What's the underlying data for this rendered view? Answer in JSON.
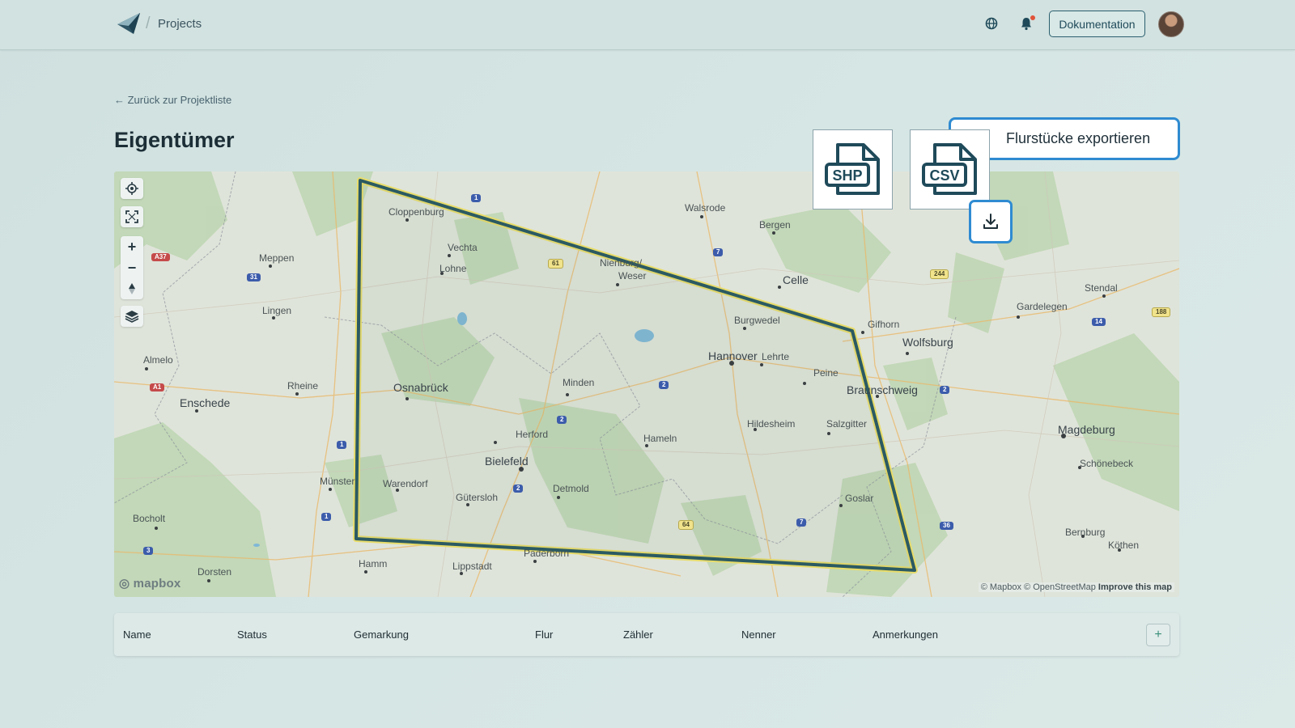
{
  "header": {
    "breadcrumb": "Projects",
    "doc_button": "Dokumentation",
    "icons": [
      "logo-icon",
      "globe-icon",
      "bell-icon",
      "avatar"
    ]
  },
  "page": {
    "back_link": "← Zurück zur Projektliste",
    "title": "Eigentümer"
  },
  "export": {
    "shp_label": "SHP",
    "csv_label": "CSV",
    "export_button": "Flurstücke exportieren",
    "download_icon": "download-icon"
  },
  "map": {
    "cities": [
      "Cloppenburg",
      "Vechta",
      "Lohne",
      "Walsrode",
      "Bergen",
      "Celle",
      "Nienburg/",
      "Weser",
      "Meppen",
      "Lingen",
      "Almelo",
      "Enschede",
      "Rheine",
      "Osnabrück",
      "Minden",
      "Burgwedel",
      "Hannover",
      "Lehrte",
      "Peine",
      "Gifhorn",
      "Wolfsburg",
      "Braunschweig",
      "Stendal",
      "Gardelegen",
      "Magdeburg",
      "Schönebeck",
      "Herford",
      "Bielefeld",
      "Hameln",
      "Hildesheim",
      "Salzgitter",
      "Münster",
      "Warendorf",
      "Gütersloh",
      "Detmold",
      "Goslar",
      "Bocholt",
      "Dorsten",
      "Hamm",
      "Lippstadt",
      "Paderborn",
      "Bernburg",
      "Köthen"
    ],
    "shields": [
      "1",
      "A37",
      "31",
      "A1",
      "61",
      "7",
      "244",
      "14",
      "188",
      "2",
      "1",
      "2",
      "2",
      "2",
      "1",
      "3",
      "64",
      "7",
      "36"
    ],
    "mapbox_label": "mapbox",
    "attribution": "© Mapbox © OpenStreetMap",
    "improve": "Improve this map",
    "controls": [
      "locate-icon",
      "fullscreen-icon",
      "zoom-in-icon",
      "zoom-out-icon",
      "compass-icon",
      "layers-icon"
    ]
  },
  "table": {
    "columns": [
      "Name",
      "Status",
      "Gemarkung",
      "Flur",
      "Zähler",
      "Nenner",
      "Anmerkungen"
    ],
    "add_label": "+"
  },
  "colors": {
    "accent": "#2f8bd1",
    "polygon_stroke": "#2b5a62",
    "polygon_halo": "#e8dc6a"
  }
}
